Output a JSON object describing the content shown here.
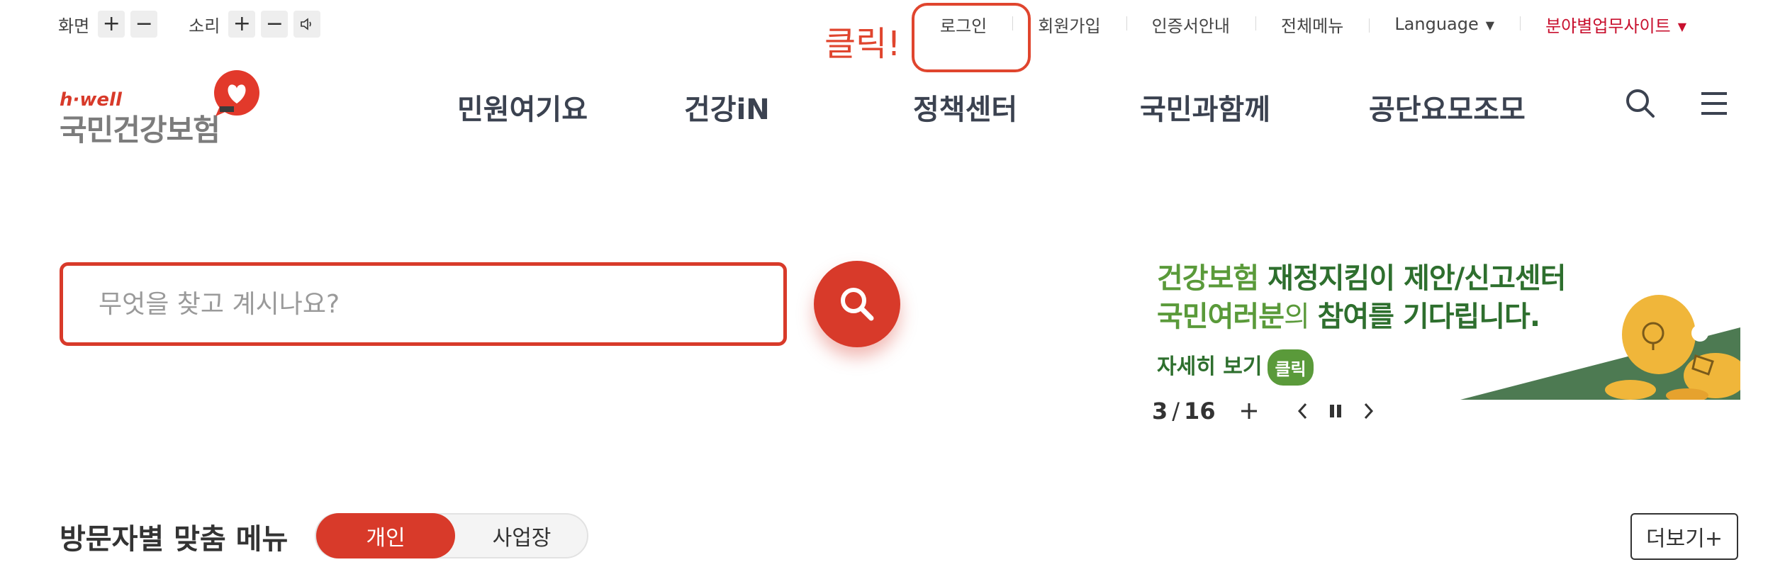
{
  "utility": {
    "screen_label": "화면",
    "sound_label": "소리",
    "plus_symbol": "+",
    "minus_symbol": "−",
    "links": {
      "login": "로그인",
      "signup": "회원가입",
      "cert": "인증서안내",
      "allmenu": "전체메뉴",
      "language": "Language",
      "sites": "분야별업무사이트"
    },
    "caret": "▼",
    "colors": {
      "sites": "#c8102e"
    }
  },
  "annotation": {
    "text": "클릭!",
    "color": "#e0452e"
  },
  "logo": {
    "small": "h·well",
    "main": "국민건강보험"
  },
  "gnb": {
    "item1": "민원여기요",
    "item2": "건강iN",
    "item3": "정책센터",
    "item4": "국민과함께",
    "item5": "공단요모조모"
  },
  "search": {
    "placeholder": "무엇을 찾고 계시나요?",
    "value": ""
  },
  "banner": {
    "line1_a": "건강보험 ",
    "line1_b": "재정지킴이 제안/신고센터",
    "line2_a": "국민여러분",
    "line2_b": "의 ",
    "line2_c": "참여를 기다립니다.",
    "more": "자세히 보기",
    "click": "클릭"
  },
  "slider": {
    "current": "3",
    "separator": "/",
    "total": "16",
    "plus": "+"
  },
  "visitor": {
    "title": "방문자별 맞춤 메뉴",
    "tab_personal": "개인",
    "tab_business": "사업장",
    "more": "더보기+"
  },
  "colors": {
    "brand_red": "#d83a2a",
    "banner_green": "#5a9a3a",
    "nav_text": "#3b4250"
  }
}
